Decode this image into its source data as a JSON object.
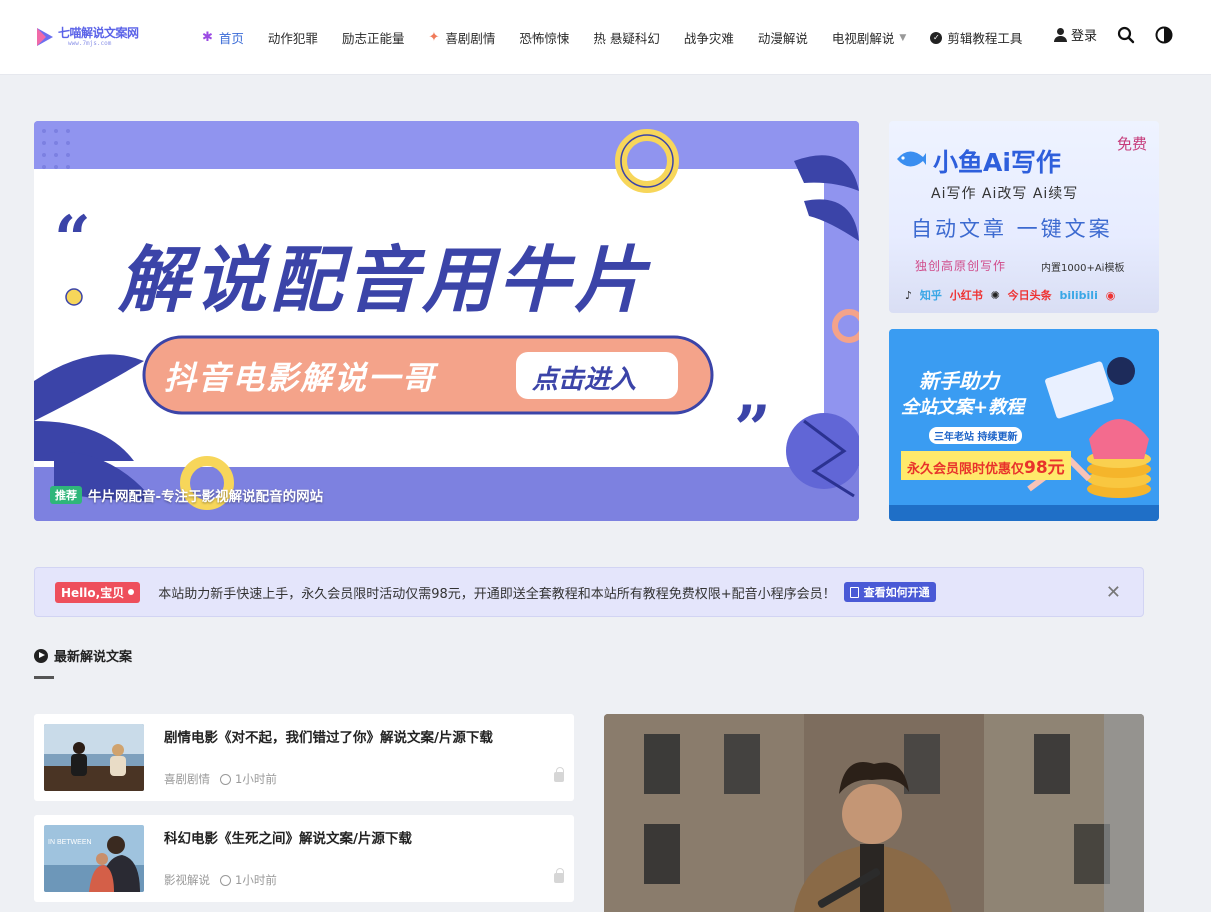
{
  "logo": {
    "name": "七喵解说文案网",
    "sub": "www.7mjs.com"
  },
  "nav": {
    "items": [
      {
        "label": "首页",
        "icon": "sparkle-icon",
        "active": true
      },
      {
        "label": "动作犯罪"
      },
      {
        "label": "励志正能量"
      },
      {
        "label": "喜剧剧情",
        "icon": "spark-icon"
      },
      {
        "label": "恐怖惊悚"
      },
      {
        "label": "热 悬疑科幻"
      },
      {
        "label": "战争灾难"
      },
      {
        "label": "动漫解说"
      },
      {
        "label": "电视剧解说",
        "dropdown": true
      },
      {
        "label": "剪辑教程工具",
        "icon": "check-circle-icon"
      }
    ],
    "login": "登录"
  },
  "hero": {
    "headline": "解说配音用牛片",
    "pill": "抖音电影解说一哥",
    "pill_button": "点击进入",
    "tag": "推荐",
    "title": "牛片网配音-专注于影视解说配音的网站"
  },
  "ads": {
    "ad1": {
      "title": "小鱼Ai写作",
      "badge": "免费",
      "line2": "Ai写作  Ai改写  Ai续写",
      "line3": "自动文章  一键文案",
      "line4": "独创高原创写作",
      "line4b": "内置1000+Ai模板",
      "platforms": [
        "知乎",
        "小红书",
        "今日头条",
        "bilibili"
      ]
    },
    "ad2": {
      "title": "新手助力",
      "subtitle": "全站文案+教程",
      "badge": "三年老站 持续更新",
      "offer": "永久会员限时优惠仅",
      "price": "98元"
    }
  },
  "notice": {
    "badge": "Hello,宝贝",
    "text": "本站助力新手快速上手，永久会员限时活动仅需98元，开通即送全套教程和本站所有教程免费权限+配音小程序会员！",
    "link": "查看如何开通"
  },
  "section": {
    "title": "最新解说文案"
  },
  "posts": [
    {
      "title": "剧情电影《对不起，我们错过了你》解说文案/片源下载",
      "category": "喜剧剧情",
      "time": "1小时前"
    },
    {
      "title": "科幻电影《生死之间》解说文案/片源下载",
      "category": "影视解说",
      "time": "1小时前",
      "thumb_text": "IN BETWEEN"
    }
  ],
  "colors": {
    "accent": "#3b6cd7",
    "notice_bg": "#e4e5fb",
    "hero_bg": "#8f93ef",
    "tag_green": "#2fb67a"
  }
}
